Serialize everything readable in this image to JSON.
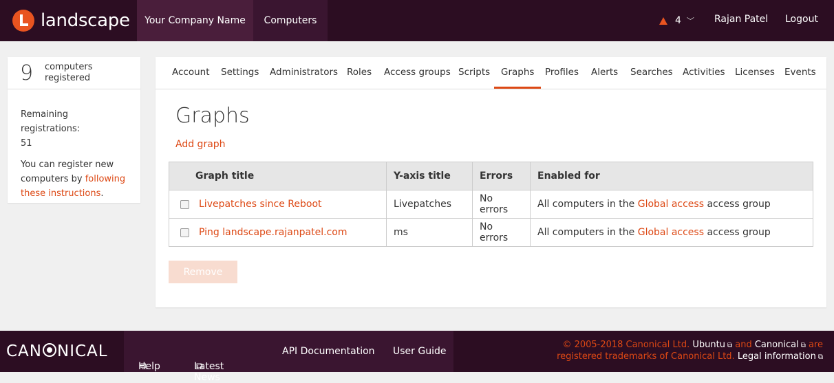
{
  "header": {
    "logo_text": "landscape",
    "company": "Your Company Name",
    "computers": "Computers",
    "alert_count": "4",
    "chevron": "﹀",
    "user": "Rajan Patel",
    "logout": "Logout"
  },
  "sidebar": {
    "count": "9",
    "count_label": "computers registered",
    "remaining_label": "Remaining registrations:",
    "remaining_value": "51",
    "register_text": "You can register new computers by",
    "register_link": "following these instructions",
    "register_suffix": "."
  },
  "tabs": [
    "Account",
    "Settings",
    "Administrators",
    "Roles",
    "Access groups",
    "Scripts",
    "Graphs",
    "Profiles",
    "Alerts",
    "Searches",
    "Activities",
    "Licenses",
    "Events"
  ],
  "active_tab": "Graphs",
  "page": {
    "title": "Graphs",
    "add_link": "Add graph",
    "remove_button": "Remove"
  },
  "table": {
    "headers": [
      "Graph title",
      "Y-axis title",
      "Errors",
      "Enabled for"
    ],
    "rows": [
      {
        "title": "Livepatches since Reboot",
        "yaxis": "Livepatches",
        "errors": "No errors",
        "enabled_prefix": "All computers in the",
        "enabled_link": "Global access",
        "enabled_suffix": "access group"
      },
      {
        "title": "Ping landscape.rajanpatel.com",
        "yaxis": "ms",
        "errors": "No errors",
        "enabled_prefix": "All computers in the",
        "enabled_link": "Global access",
        "enabled_suffix": "access group"
      }
    ]
  },
  "footer": {
    "brand": {
      "pre": "CAN",
      "post": "NICAL"
    },
    "links": [
      "Help",
      "Latest News",
      "API Documentation",
      "User Guide"
    ],
    "ext_icon": "⧉",
    "legal": {
      "copyright": "© 2005-2018 Canonical Ltd.",
      "ubuntu": "Ubuntu",
      "and": "and",
      "canonical": "Canonical",
      "are": "are",
      "registered": "registered trademarks of Canonical Ltd.",
      "legal_info": "Legal information"
    }
  },
  "colors": {
    "brand": "#2c0d22",
    "accent": "#dd4814",
    "orange": "#e95420"
  }
}
